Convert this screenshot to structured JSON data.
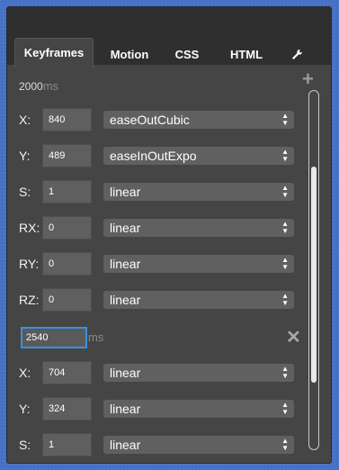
{
  "tabs": [
    {
      "label": "Keyframes",
      "active": true
    },
    {
      "label": "Motion",
      "active": false
    },
    {
      "label": "CSS",
      "active": false
    },
    {
      "label": "HTML",
      "active": false
    }
  ],
  "icons": {
    "settings": "wrench-icon",
    "add": "plus-icon",
    "remove": "close-icon"
  },
  "keyframes": [
    {
      "time_partial": "2000",
      "time_unit": "ms",
      "rows": [
        {
          "label": "X:",
          "value": "840",
          "easing": "easeOutCubic"
        },
        {
          "label": "Y:",
          "value": "489",
          "easing": "easeInOutExpo"
        },
        {
          "label": "S:",
          "value": "1",
          "easing": "linear"
        },
        {
          "label": "RX:",
          "value": "0",
          "easing": "linear"
        },
        {
          "label": "RY:",
          "value": "0",
          "easing": "linear"
        },
        {
          "label": "RZ:",
          "value": "0",
          "easing": "linear"
        }
      ]
    },
    {
      "time": "2540",
      "time_unit": "ms",
      "rows": [
        {
          "label": "X:",
          "value": "704",
          "easing": "linear"
        },
        {
          "label": "Y:",
          "value": "324",
          "easing": "linear"
        },
        {
          "label": "S:",
          "value": "1",
          "easing": "linear"
        }
      ]
    }
  ],
  "colors": {
    "accent": "#3b8fe0",
    "panel": "#454545",
    "background": "#4a74c7"
  }
}
